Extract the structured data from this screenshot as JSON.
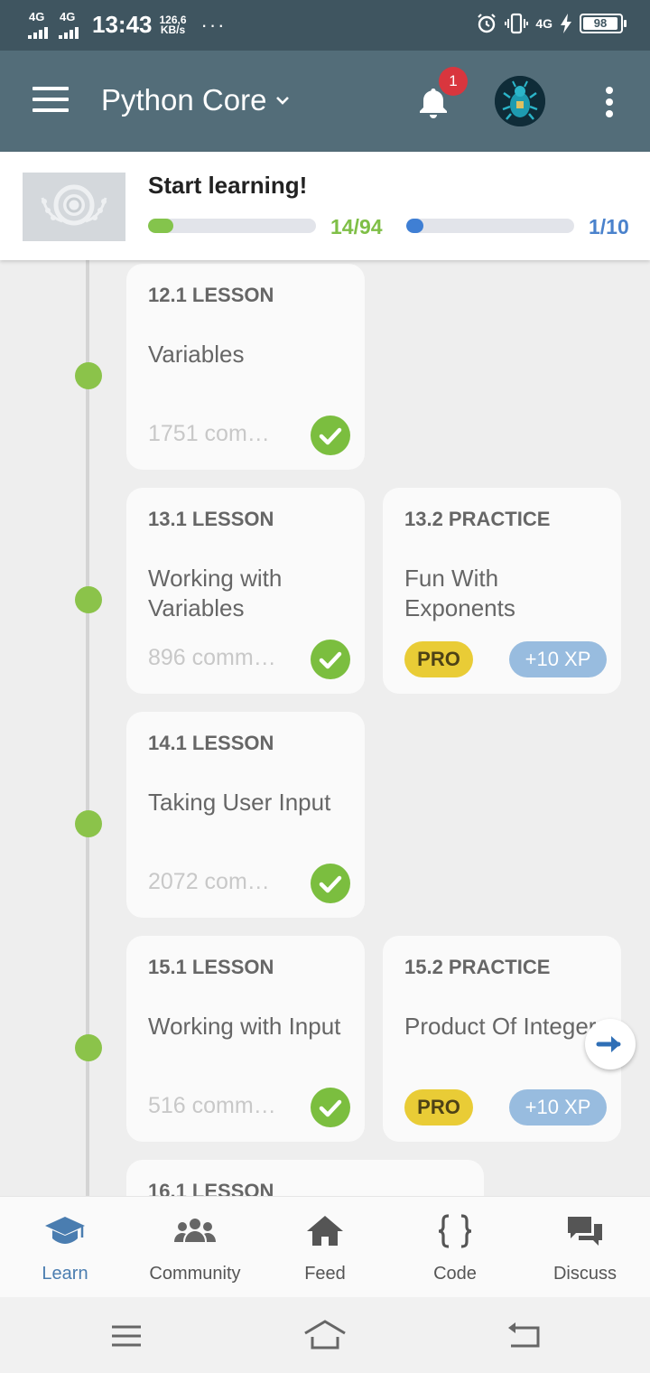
{
  "status_bar": {
    "network1": "4G",
    "network2": "4G",
    "time": "13:43",
    "speed_value": "126,6",
    "speed_unit": "KB/s",
    "more": "···",
    "network3": "4G",
    "battery": "98"
  },
  "app_bar": {
    "course_title": "Python Core",
    "notification_count": "1",
    "icons": [
      "menu-icon",
      "chevron-down-icon",
      "bell-icon",
      "avatar",
      "more-vert-icon"
    ]
  },
  "progress": {
    "title": "Start learning!",
    "lessons_count": "14/94",
    "lessons_fraction": 0.149,
    "goal_count": "1/10",
    "goal_fraction": 0.1,
    "colors": {
      "green": "#84c44c",
      "blue": "#3f7fd4"
    }
  },
  "modules": [
    {
      "items": [
        {
          "kind": "12.1 LESSON",
          "title": "Variables",
          "comments": "1751 comments",
          "completed": true
        }
      ]
    },
    {
      "items": [
        {
          "kind": "13.1 LESSON",
          "title": "Working with Variables",
          "comments": "896 comments",
          "completed": true
        },
        {
          "kind": "13.2 PRACTICE",
          "title": "Fun With Exponents",
          "pro": "PRO",
          "xp": "+10 XP"
        }
      ]
    },
    {
      "items": [
        {
          "kind": "14.1 LESSON",
          "title": "Taking User Input",
          "comments": "2072 comments",
          "completed": true
        }
      ]
    },
    {
      "items": [
        {
          "kind": "15.1 LESSON",
          "title": "Working with Input",
          "comments": "516 comments",
          "completed": true
        },
        {
          "kind": "15.2 PRACTICE",
          "title": "Product Of Integers",
          "pro": "PRO",
          "xp": "+10 XP"
        }
      ]
    },
    {
      "items": [
        {
          "kind": "16.1 LESSON"
        }
      ]
    }
  ],
  "bottom_nav": [
    {
      "label": "Learn",
      "icon": "graduation-cap-icon",
      "active": true
    },
    {
      "label": "Community",
      "icon": "people-icon"
    },
    {
      "label": "Feed",
      "icon": "home-icon"
    },
    {
      "label": "Code",
      "icon": "braces-icon"
    },
    {
      "label": "Discuss",
      "icon": "chat-icon"
    }
  ],
  "system_nav": [
    "menu-icon",
    "home-icon",
    "back-icon"
  ],
  "colors": {
    "status_bar": "#3f5560",
    "app_bar": "#536d79",
    "accent_green": "#7bbe3f",
    "pro_yellow": "#e9cc36",
    "xp_blue": "#98bcdf",
    "active_tab": "#4a7db0"
  }
}
